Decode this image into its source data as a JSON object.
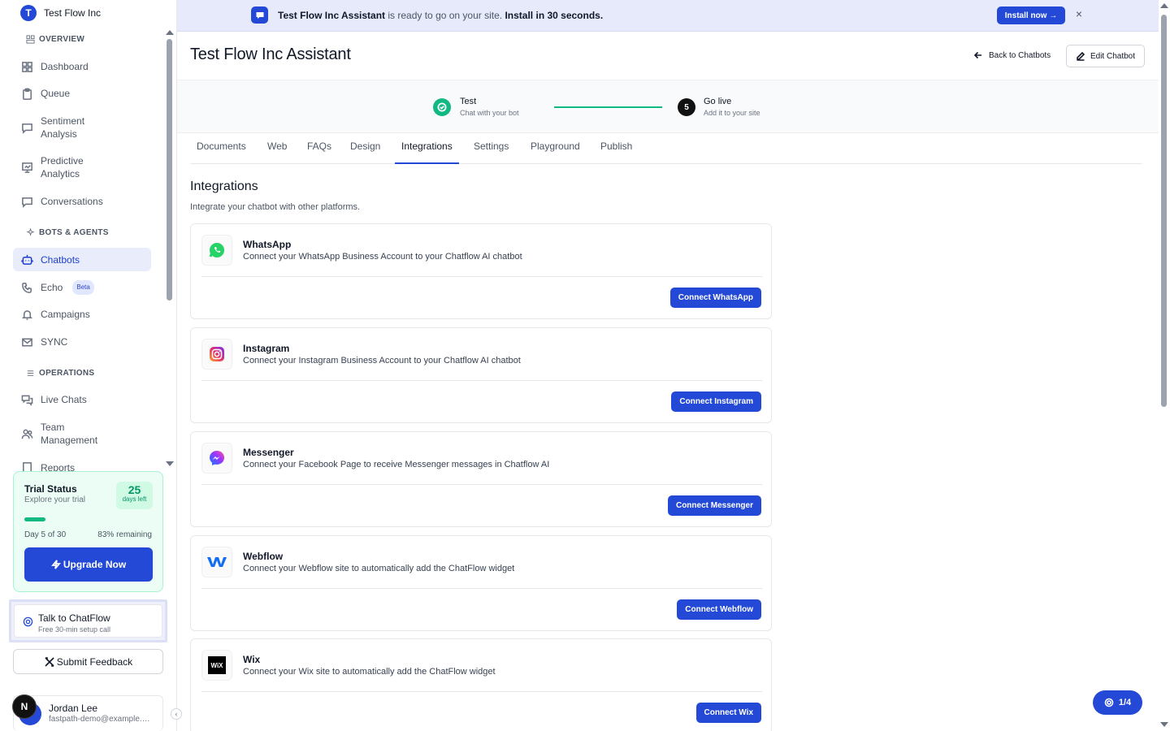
{
  "org": {
    "initial": "T",
    "name": "Test Flow Inc"
  },
  "sidebar": {
    "sections": [
      {
        "title": "OVERVIEW",
        "icon": "layout-icon"
      },
      {
        "title": "BOTS & AGENTS",
        "icon": "sparkles-icon"
      },
      {
        "title": "OPERATIONS",
        "icon": "list-icon"
      }
    ],
    "items": [
      {
        "label": "Dashboard",
        "icon": "grid-icon"
      },
      {
        "label": "Queue",
        "icon": "clipboard-icon"
      },
      {
        "label": "Sentiment Analysis",
        "icon": "chat-icon"
      },
      {
        "label": "Predictive Analytics",
        "icon": "presentation-icon"
      },
      {
        "label": "Conversations",
        "icon": "message-icon"
      },
      {
        "label": "Chatbots",
        "icon": "bot-icon"
      },
      {
        "label": "Echo",
        "icon": "phone-icon",
        "badge": "Beta"
      },
      {
        "label": "Campaigns",
        "icon": "bell-icon"
      },
      {
        "label": "SYNC",
        "icon": "mail-icon"
      },
      {
        "label": "Live Chats",
        "icon": "chats-icon"
      },
      {
        "label": "Team Management",
        "icon": "users-icon"
      },
      {
        "label": "Reports",
        "icon": "report-icon"
      }
    ]
  },
  "trial": {
    "title": "Trial Status",
    "subtitle": "Explore your trial",
    "days_number": "25",
    "days_label": "days left",
    "progress_fraction": 0.167,
    "day_text": "Day 5 of 30",
    "remaining_text": "83% remaining",
    "upgrade_label": "Upgrade Now"
  },
  "talk": {
    "title": "Talk to ChatFlow",
    "subtitle": "Free 30-min setup call"
  },
  "feedback_label": "Submit Feedback",
  "user": {
    "initial": "N",
    "name": "Jordan Lee",
    "email": "fastpath-demo@example.com"
  },
  "banner": {
    "bold_text": "Test Flow Inc Assistant",
    "text": "is ready to go on your site.",
    "bold_text2": "Install in 30 seconds.",
    "install_label": "Install now →",
    "close_label": "×"
  },
  "page": {
    "title": "Test Flow Inc Assistant",
    "back_label": "Back to Chatbots",
    "edit_label": "Edit Chatbot"
  },
  "steps": [
    {
      "title": "Test",
      "subtitle": "Chat with your bot",
      "status": "done"
    },
    {
      "number": "5",
      "title": "Go live",
      "subtitle": "Add it to your site"
    }
  ],
  "tabs": [
    "Documents",
    "Web",
    "FAQs",
    "Design",
    "Integrations",
    "Settings",
    "Playground",
    "Publish"
  ],
  "active_tab": "Integrations",
  "integrations": {
    "title": "Integrations",
    "subtitle": "Integrate your chatbot with other platforms.",
    "cards": [
      {
        "name": "WhatsApp",
        "desc": "Connect your WhatsApp Business Account to your Chatflow AI chatbot",
        "button": "Connect WhatsApp",
        "icon": "whatsapp-icon",
        "color": "#25d366"
      },
      {
        "name": "Instagram",
        "desc": "Connect your Instagram Business Account to your Chatflow AI chatbot",
        "button": "Connect Instagram",
        "icon": "instagram-icon",
        "color": "#e1306c"
      },
      {
        "name": "Messenger",
        "desc": "Connect your Facebook Page to receive Messenger messages in Chatflow AI",
        "button": "Connect Messenger",
        "icon": "messenger-icon",
        "color": "#7c3aed"
      },
      {
        "name": "Webflow",
        "desc": "Connect your Webflow site to automatically add the ChatFlow widget",
        "button": "Connect Webflow",
        "icon": "webflow-icon",
        "color": "#146ef5"
      },
      {
        "name": "Wix",
        "desc": "Connect your Wix site to automatically add the ChatFlow widget",
        "button": "Connect Wix",
        "icon": "wix-icon",
        "logo_text": "WiX",
        "color": "#000000"
      }
    ]
  },
  "pager_label": "1/4",
  "colors": {
    "accent": "#2349d6",
    "success": "#10b981"
  }
}
